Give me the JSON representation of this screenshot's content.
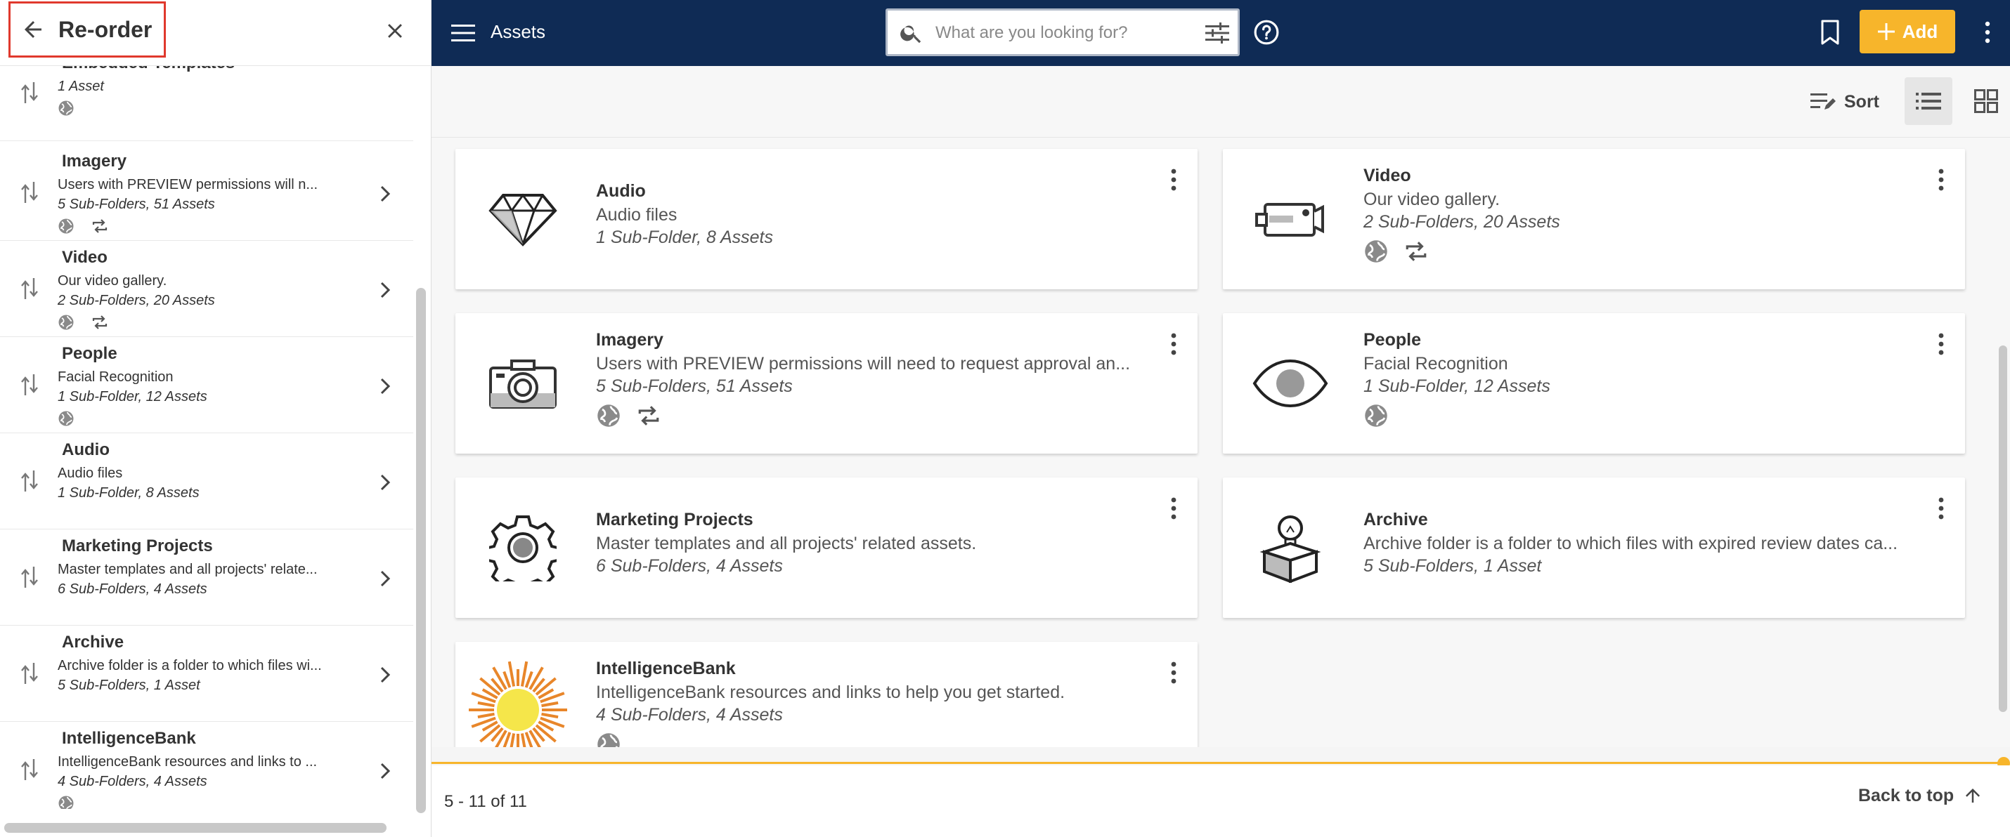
{
  "reorder_panel": {
    "title": "Re-order",
    "items": [
      {
        "name": "Embedded Templates",
        "desc": "",
        "counts": "1 Asset",
        "public": true,
        "sync": false,
        "has_children": false
      },
      {
        "name": "Imagery",
        "desc": "Users with PREVIEW permissions will n...",
        "counts": "5 Sub-Folders, 51 Assets",
        "public": true,
        "sync": true,
        "has_children": true
      },
      {
        "name": "Video",
        "desc": "Our video gallery.",
        "counts": "2 Sub-Folders, 20 Assets",
        "public": true,
        "sync": true,
        "has_children": true
      },
      {
        "name": "People",
        "desc": "Facial Recognition",
        "counts": "1 Sub-Folder, 12 Assets",
        "public": true,
        "sync": false,
        "has_children": true
      },
      {
        "name": "Audio",
        "desc": "Audio files",
        "counts": "1 Sub-Folder, 8 Assets",
        "public": false,
        "sync": false,
        "has_children": true
      },
      {
        "name": "Marketing Projects",
        "desc": "Master templates and all projects' relate...",
        "counts": "6 Sub-Folders, 4 Assets",
        "public": false,
        "sync": false,
        "has_children": true
      },
      {
        "name": "Archive",
        "desc": "Archive folder is a folder to which files wi...",
        "counts": "5 Sub-Folders, 1 Asset",
        "public": false,
        "sync": false,
        "has_children": true
      },
      {
        "name": "IntelligenceBank",
        "desc": "IntelligenceBank resources and links to ...",
        "counts": "4 Sub-Folders, 4 Assets",
        "public": true,
        "sync": false,
        "has_children": true
      }
    ]
  },
  "topbar": {
    "title": "Assets",
    "search_placeholder": "What are you looking for?",
    "add_label": "Add",
    "background": "#0f2b55",
    "accent": "#f7b52b"
  },
  "toolbar": {
    "sort_label": "Sort",
    "view_mode": "list"
  },
  "folders": [
    {
      "name": "Audio",
      "desc": "Audio files",
      "counts": "1 Sub-Folder, 8 Assets",
      "icon": "diamond-icon",
      "public": false,
      "sync": false
    },
    {
      "name": "Video",
      "desc": "Our video gallery.",
      "counts": "2 Sub-Folders, 20 Assets",
      "icon": "video-camera-icon",
      "public": true,
      "sync": true
    },
    {
      "name": "Imagery",
      "desc": "Users with PREVIEW permissions will need to request approval an...",
      "counts": "5 Sub-Folders, 51 Assets",
      "icon": "camera-icon",
      "public": true,
      "sync": true
    },
    {
      "name": "People",
      "desc": "Facial Recognition",
      "counts": "1 Sub-Folder, 12 Assets",
      "icon": "eye-icon",
      "public": true,
      "sync": false
    },
    {
      "name": "Marketing Projects",
      "desc": "Master templates and all projects' related assets.",
      "counts": "6 Sub-Folders, 4 Assets",
      "icon": "gear-icon",
      "public": false,
      "sync": false
    },
    {
      "name": "Archive",
      "desc": "Archive folder is a folder to which files with expired review dates ca...",
      "counts": "5 Sub-Folders, 1 Asset",
      "icon": "lightbulb-box-icon",
      "public": false,
      "sync": false
    },
    {
      "name": "IntelligenceBank",
      "desc": "IntelligenceBank resources and links to help you get started.",
      "counts": "4 Sub-Folders, 4 Assets",
      "icon": "sun-icon",
      "public": true,
      "sync": false
    }
  ],
  "footer": {
    "range": "5 - 11 of 11",
    "back_to_top": "Back to top"
  }
}
